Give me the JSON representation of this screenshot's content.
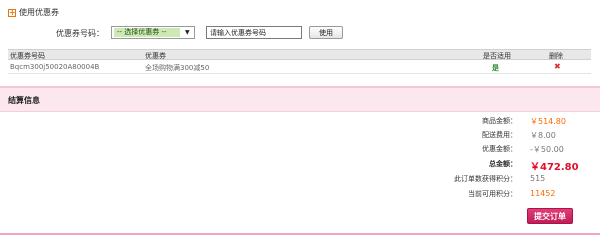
{
  "coupon": {
    "use_label": "使用优惠券",
    "expand_symbol": "+",
    "code_label": "优惠券号码：",
    "select_value": "-- 选择优惠券 --",
    "select_arrow": "▼",
    "input_value": "请输入优惠券号码",
    "apply_label": "使用",
    "table": {
      "headers": [
        "优惠券号码",
        "优惠券",
        "是否适用",
        "删除"
      ],
      "rows": [
        {
          "code": "Bqcm300j50020A80004B",
          "name": "全场购物满300减50",
          "applicable": "是",
          "delete_symbol": "✖"
        }
      ]
    }
  },
  "settlement": {
    "title": "结算信息",
    "goods_amount_label": "商品金额：",
    "goods_amount_value": "￥514.80",
    "shipping_label": "配送费用：",
    "shipping_value": "￥8.00",
    "discount_label": "优惠金额：",
    "discount_value": "-￥50.00",
    "total_label": "总金额：",
    "total_value": "￥472.80",
    "points_earned_label": "此订单数获得积分：",
    "points_earned_value": "515",
    "points_available_label": "当前可用积分：",
    "points_available_value": "11452",
    "submit_label": "提交订单"
  },
  "colors": {
    "accent": "#c21b57",
    "price": "#ff6a00",
    "total": "#e0102a"
  }
}
